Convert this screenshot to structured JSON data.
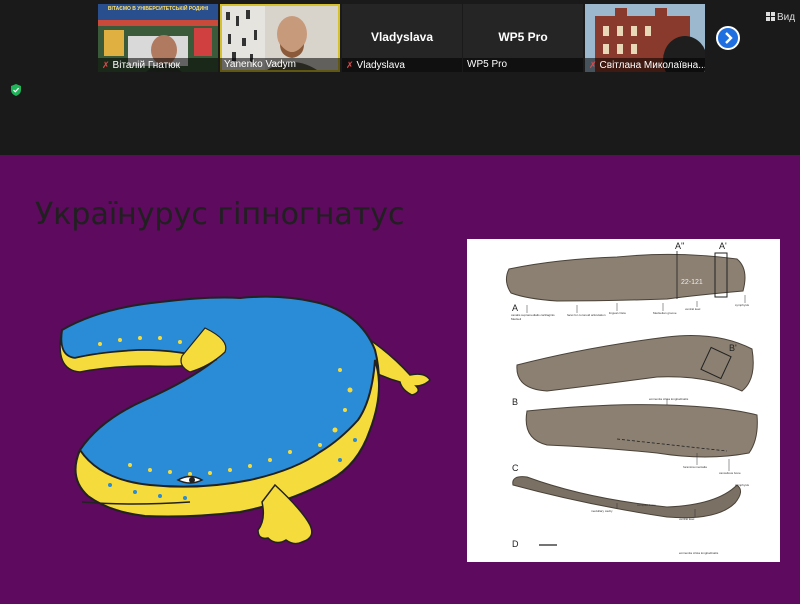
{
  "meeting": {
    "view_button": "Вид",
    "participants": [
      {
        "name": "Віталій Гнатюк",
        "muted": true,
        "video": true,
        "banner": "ВІТАЄМО В УНІВЕРСИТЕТСЬКІЙ РОДИНІ"
      },
      {
        "name": "Yanenko Vadym",
        "muted": false,
        "video": true
      },
      {
        "name": "Vladyslava",
        "muted": true,
        "video": false,
        "display": "Vladyslava"
      },
      {
        "name": "WP5 Pro",
        "muted": false,
        "video": false,
        "display": "WP5 Pro"
      },
      {
        "name": "Світлана Миколаївна...",
        "muted": true,
        "video": true
      }
    ]
  },
  "slide": {
    "title": "Украïнурус гіпногнатус",
    "figure": {
      "panels": [
        "A",
        "B",
        "C",
        "D"
      ],
      "markers": [
        "A''",
        "A'",
        "B'"
      ],
      "specimen_number": "22-121",
      "annotations": [
        "canalis supramedialis cartilaginis Meckeli",
        "facet for coronoid articulation",
        "lingual crista",
        "Meckelian groove",
        "ventral keel",
        "symphysis",
        "eminentia crista longitudinalis",
        "foramina mentalia",
        "cancellous bone",
        "medullary cavity",
        "compact bone",
        "ventral keel",
        "symphysis",
        "eminentia crista longitudinalis"
      ]
    }
  },
  "colors": {
    "slide_bg": "#5e0a5e",
    "blue": "#2a8bd6",
    "yellow": "#f5dc3c",
    "accent": "#1f6fe0"
  }
}
